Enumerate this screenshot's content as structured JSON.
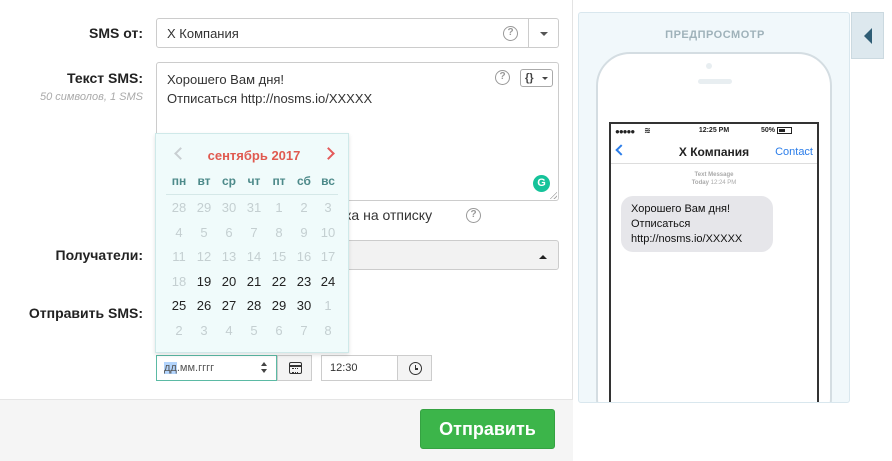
{
  "form": {
    "sender_label": "SMS от:",
    "sender_value": "X Компания",
    "text_label": "Текст SMS:",
    "text_counter": "50 символов, 1 SMS",
    "sms_text": "Хорошего Вам дня!\nОтписаться http://nosms.io/XXXXX",
    "var_button_label": "{}",
    "grammarly_label": "G",
    "help_label": "?",
    "unsub_text": "ка на отписку",
    "recipients_label": "Получатели:",
    "send_label": "Отправить SMS:",
    "date_placeholder_selected": "дд",
    "date_placeholder_rest": ".мм.гггг",
    "time_value": "12:30",
    "submit_label": "Отправить"
  },
  "calendar": {
    "title": "сентябрь 2017",
    "weekdays": [
      "пн",
      "вт",
      "ср",
      "чт",
      "пт",
      "сб",
      "вс"
    ],
    "weeks": [
      [
        "28",
        "29",
        "30",
        "31",
        "1",
        "2",
        "3"
      ],
      [
        "4",
        "5",
        "6",
        "7",
        "8",
        "9",
        "10"
      ],
      [
        "11",
        "12",
        "13",
        "14",
        "15",
        "16",
        "17"
      ],
      [
        "18",
        "19",
        "20",
        "21",
        "22",
        "23",
        "24"
      ],
      [
        "25",
        "26",
        "27",
        "28",
        "29",
        "30",
        "1"
      ],
      [
        "2",
        "3",
        "4",
        "5",
        "6",
        "7",
        "8"
      ]
    ],
    "disabled": [
      [
        true,
        true,
        true,
        true,
        true,
        true,
        true
      ],
      [
        true,
        true,
        true,
        true,
        true,
        true,
        true
      ],
      [
        true,
        true,
        true,
        true,
        true,
        true,
        true
      ],
      [
        true,
        false,
        false,
        false,
        false,
        false,
        false
      ],
      [
        false,
        false,
        false,
        false,
        false,
        false,
        true
      ],
      [
        true,
        true,
        true,
        true,
        true,
        true,
        true
      ]
    ],
    "colors": {
      "title": "#e05a50",
      "weekday": "#4d8a8a",
      "disabled": "#c4cfd1",
      "enabled": "#222222"
    }
  },
  "preview": {
    "title": "ПРЕДПРОСМОТР",
    "status_dots": "●●●●●",
    "status_wifi": "≋",
    "status_time": "12:25 PM",
    "status_battery": "50%",
    "contact_name": "X Компания",
    "contact_link": "Contact",
    "meta_label": "Text Message",
    "meta_day": "Today",
    "meta_time": "12:24 PM",
    "bubble_text": "Хорошего Вам дня!\nОтписаться\nhttp://nosms.io/XXXXX"
  },
  "colors": {
    "accent_green": "#3cb54a",
    "link_blue": "#2b7de9",
    "focus_teal": "#5bbaa4"
  }
}
